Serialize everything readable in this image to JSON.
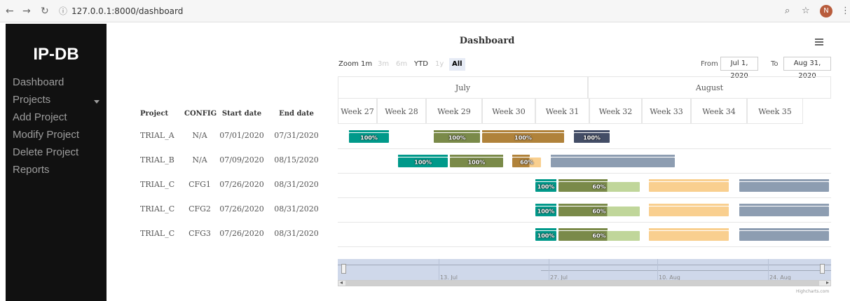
{
  "browser": {
    "url": "127.0.0.1:8000/dashboard",
    "avatar_letter": "N"
  },
  "sidebar": {
    "brand": "IP-DB",
    "items": [
      {
        "label": "Dashboard"
      },
      {
        "label": "Projects"
      },
      {
        "label": "Add Project"
      },
      {
        "label": "Modify Project"
      },
      {
        "label": "Delete Project"
      },
      {
        "label": "Reports"
      }
    ]
  },
  "chart": {
    "title": "Dashboard",
    "zoom_label": "Zoom",
    "zoom_buttons": [
      "1m",
      "3m",
      "6m",
      "YTD",
      "1y",
      "All"
    ],
    "from_label": "From",
    "from_value": "Jul 1, 2020",
    "to_label": "To",
    "to_value": "Aug 31, 2020",
    "credits": "Highcharts.com"
  },
  "table": {
    "headers": [
      "Project",
      "CONFIG",
      "Start date",
      "End date"
    ],
    "rows": [
      [
        "TRIAL_A",
        "N/A",
        "07/01/2020",
        "07/31/2020"
      ],
      [
        "TRIAL_B",
        "N/A",
        "07/09/2020",
        "08/15/2020"
      ],
      [
        "TRIAL_C",
        "CFG1",
        "07/26/2020",
        "08/31/2020"
      ],
      [
        "TRIAL_C",
        "CFG2",
        "07/26/2020",
        "08/31/2020"
      ],
      [
        "TRIAL_C",
        "CFG3",
        "07/26/2020",
        "08/31/2020"
      ]
    ]
  },
  "colors": {
    "teal": "#00998a",
    "olive": "#7a8a49",
    "bronze": "#b0823a",
    "slate": "#434d66",
    "peach": "#f9cf8f",
    "grey": "#8d9db1",
    "lightgreen": "#c0d69a",
    "tealtrack": "#00998a"
  },
  "chart_data": {
    "type": "gantt",
    "months": [
      "July",
      "August"
    ],
    "weeks": [
      "Week 27",
      "Week 28",
      "Week 29",
      "Week 30",
      "Week 31",
      "Week 32",
      "Week 33",
      "Week 34",
      "Week 35"
    ],
    "navigator_ticks": [
      "13. Jul",
      "27. Jul",
      "10. Aug",
      "24. Aug"
    ],
    "tasks": [
      {
        "row": 0,
        "start": "2020-07-01",
        "end": "2020-07-08",
        "completed": 1.0,
        "label": "100%",
        "color": "teal"
      },
      {
        "row": 0,
        "start": "2020-07-14",
        "end": "2020-07-20",
        "completed": 1.0,
        "label": "100%",
        "color": "olive"
      },
      {
        "row": 0,
        "start": "2020-07-20",
        "end": "2020-07-31",
        "completed": 1.0,
        "label": "100%",
        "color": "bronze"
      },
      {
        "row": 0,
        "start": "2020-08-01",
        "end": "2020-08-06",
        "completed": 1.0,
        "label": "100%",
        "color": "slate"
      },
      {
        "row": 1,
        "start": "2020-07-09",
        "end": "2020-07-16",
        "completed": 1.0,
        "label": "100%",
        "color": "teal"
      },
      {
        "row": 1,
        "start": "2020-07-16",
        "end": "2020-07-23",
        "completed": 1.0,
        "label": "100%",
        "color": "olive"
      },
      {
        "row": 1,
        "start": "2020-07-24",
        "end": "2020-07-28",
        "completed": 0.6,
        "label": "60%",
        "color": "bronze",
        "rest": "peach"
      },
      {
        "row": 1,
        "start": "2020-07-29",
        "end": "2020-08-15",
        "completed": 1.0,
        "label": "",
        "color": "grey"
      },
      {
        "row": 2,
        "start": "2020-07-27",
        "end": "2020-07-30",
        "completed": 1.0,
        "label": "100%",
        "color": "teal"
      },
      {
        "row": 2,
        "start": "2020-07-30",
        "end": "2020-08-10",
        "completed": 0.6,
        "label": "60%",
        "color": "olive",
        "rest": "lightgreen"
      },
      {
        "row": 2,
        "start": "2020-08-11",
        "end": "2020-08-22",
        "completed": 1.0,
        "label": "",
        "color": "peach"
      },
      {
        "row": 2,
        "start": "2020-08-23",
        "end": "2020-08-31",
        "completed": 1.0,
        "label": "",
        "color": "grey"
      },
      {
        "row": 3,
        "start": "2020-07-27",
        "end": "2020-07-30",
        "completed": 1.0,
        "label": "100%",
        "color": "teal"
      },
      {
        "row": 3,
        "start": "2020-07-30",
        "end": "2020-08-10",
        "completed": 0.6,
        "label": "60%",
        "color": "olive",
        "rest": "lightgreen"
      },
      {
        "row": 3,
        "start": "2020-08-11",
        "end": "2020-08-22",
        "completed": 1.0,
        "label": "",
        "color": "peach"
      },
      {
        "row": 3,
        "start": "2020-08-23",
        "end": "2020-08-31",
        "completed": 1.0,
        "label": "",
        "color": "grey"
      },
      {
        "row": 4,
        "start": "2020-07-27",
        "end": "2020-07-30",
        "completed": 1.0,
        "label": "100%",
        "color": "teal"
      },
      {
        "row": 4,
        "start": "2020-07-30",
        "end": "2020-08-10",
        "completed": 0.6,
        "label": "60%",
        "color": "olive",
        "rest": "lightgreen"
      },
      {
        "row": 4,
        "start": "2020-08-11",
        "end": "2020-08-22",
        "completed": 1.0,
        "label": "",
        "color": "peach"
      },
      {
        "row": 4,
        "start": "2020-08-23",
        "end": "2020-08-31",
        "completed": 1.0,
        "label": "",
        "color": "grey"
      }
    ]
  }
}
